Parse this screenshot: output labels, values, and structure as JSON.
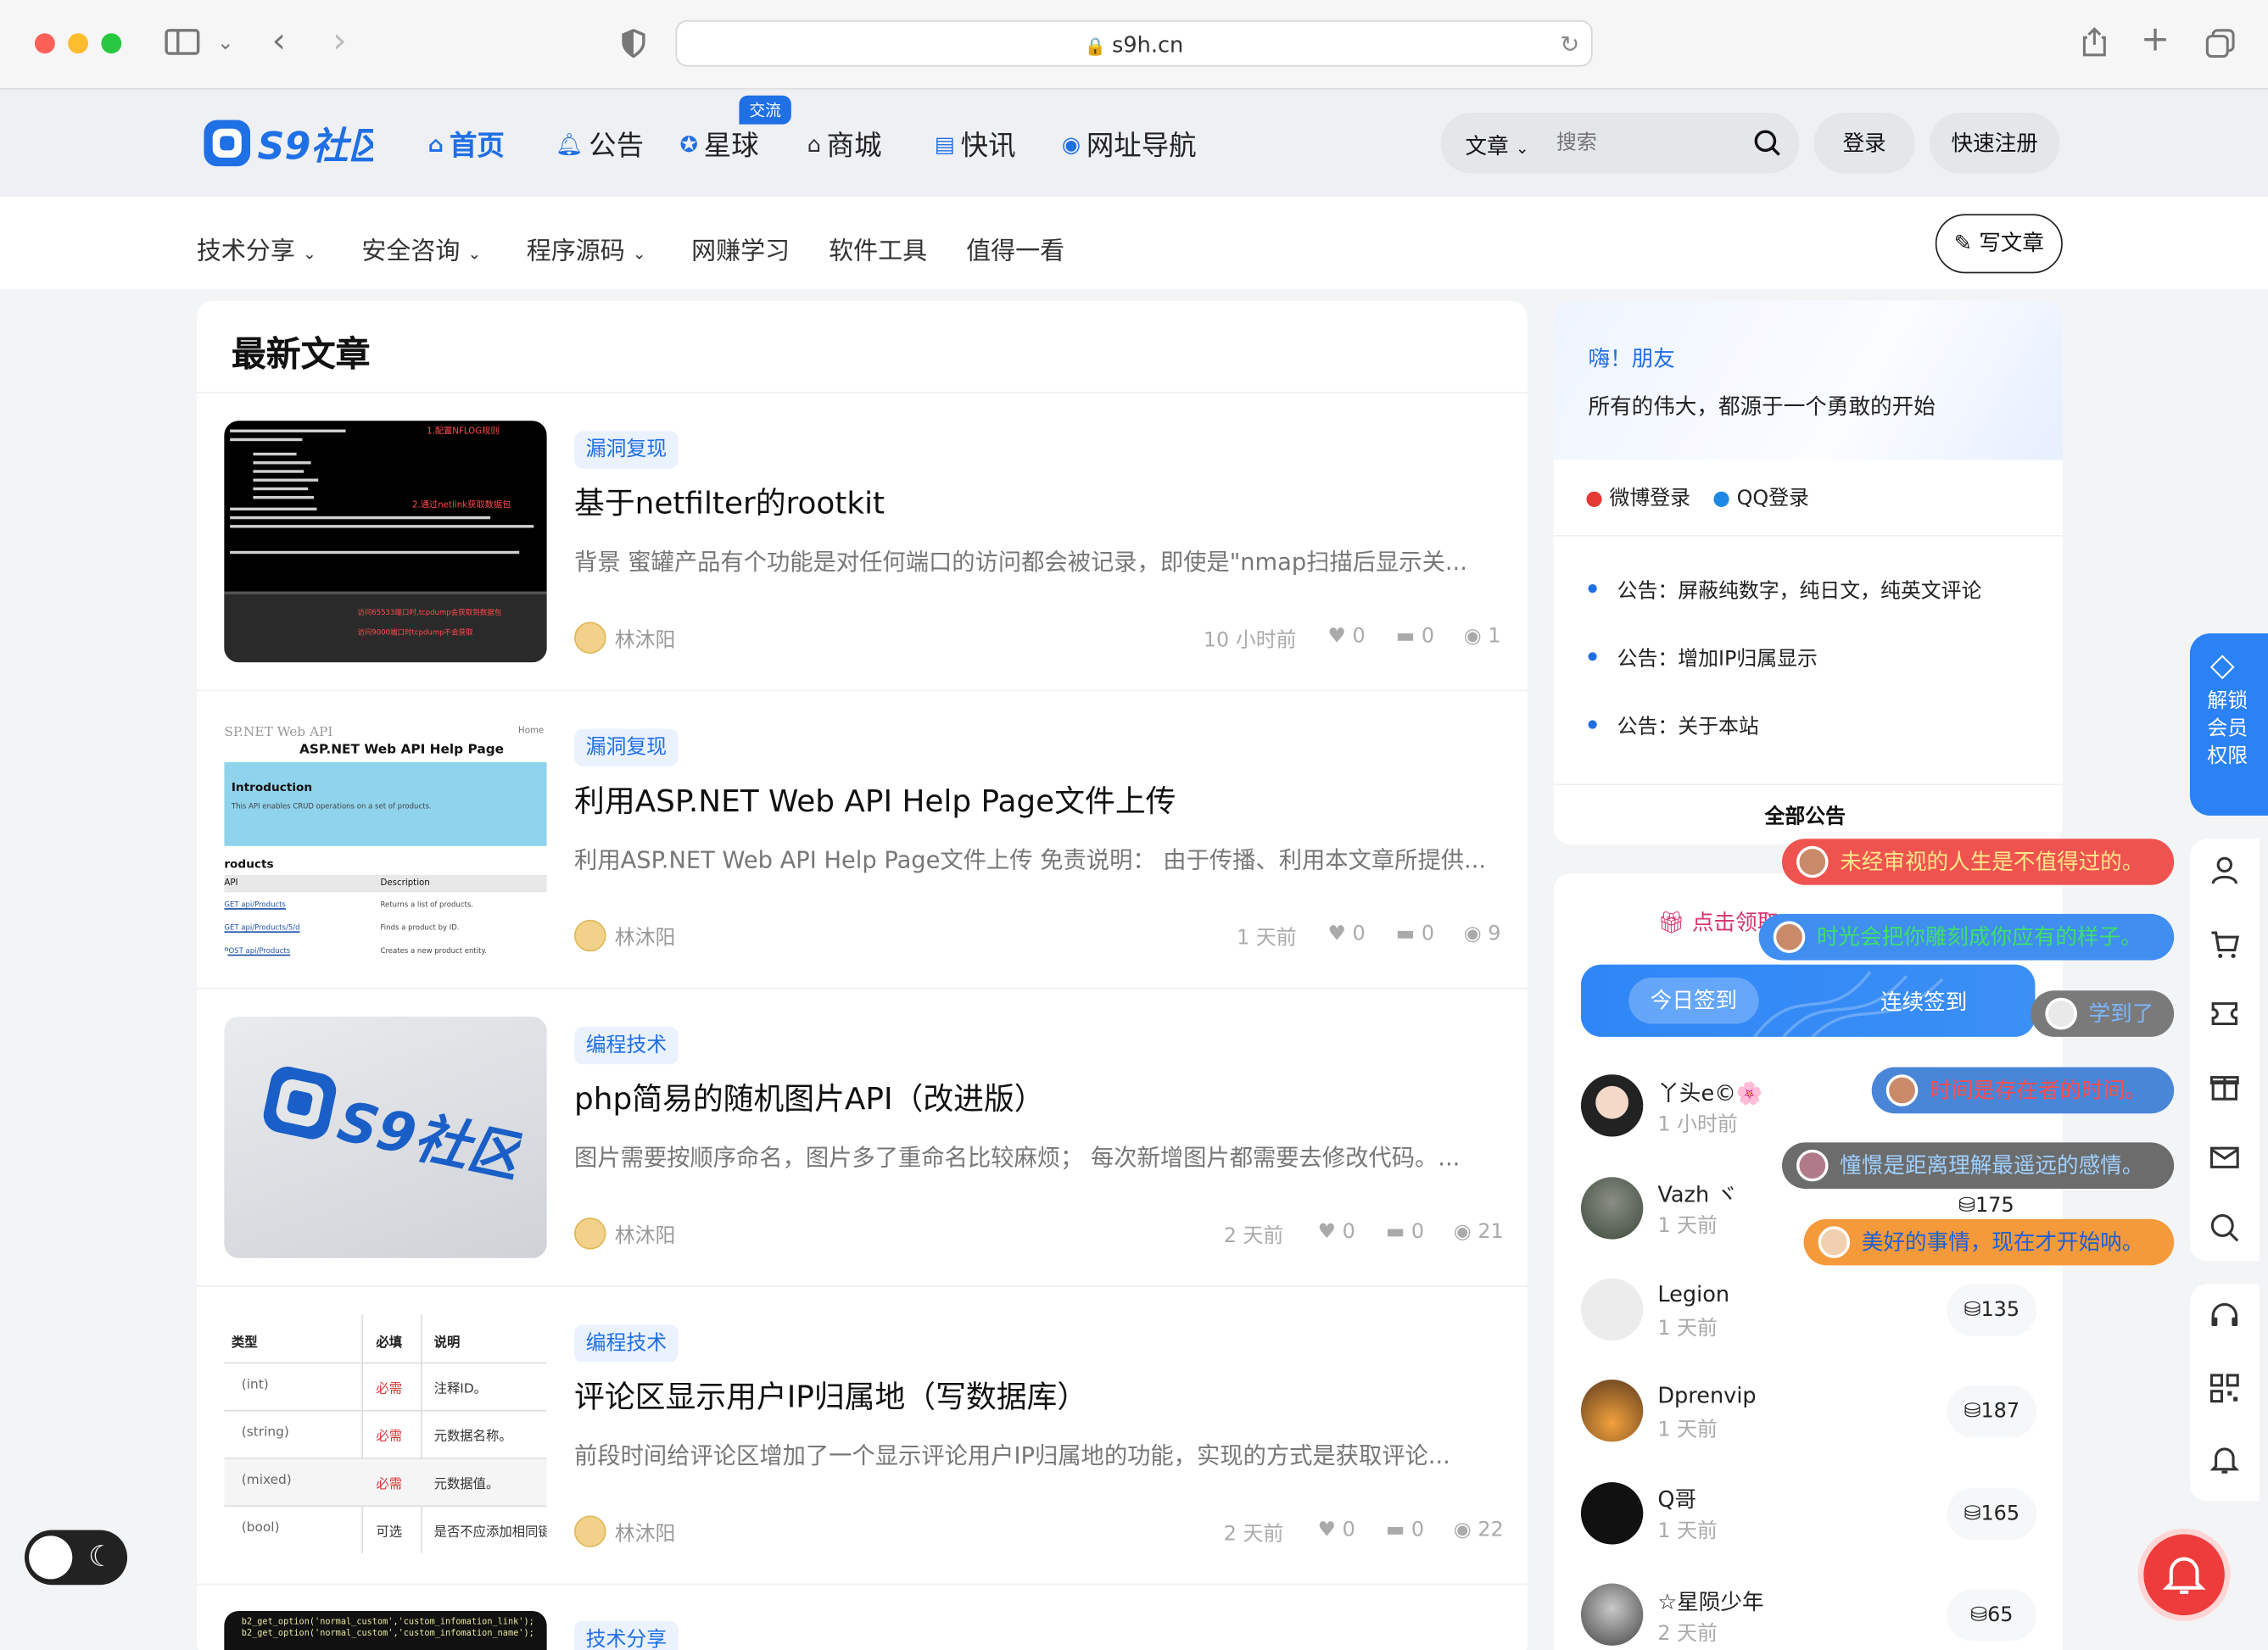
{
  "browser": {
    "url": "s9h.cn"
  },
  "site": {
    "logo_text": "S9社区",
    "nav": [
      {
        "label": "首页",
        "icon": "home-icon"
      },
      {
        "label": "公告",
        "icon": "bell-icon"
      },
      {
        "label": "星球",
        "icon": "planet-icon",
        "badge": "交流"
      },
      {
        "label": "商城",
        "icon": "store-icon"
      },
      {
        "label": "快讯",
        "icon": "news-icon"
      },
      {
        "label": "网址导航",
        "icon": "location-icon"
      }
    ],
    "search": {
      "type_label": "文章",
      "placeholder": "搜索"
    },
    "login_label": "登录",
    "register_label": "快速注册",
    "subnav": [
      "技术分享",
      "安全咨询",
      "程序源码",
      "网赚学习",
      "软件工具",
      "值得一看"
    ],
    "write_label": "写文章"
  },
  "main": {
    "title": "最新文章",
    "articles": [
      {
        "tag": "漏洞复现",
        "title": "基于netfilter的rootkit",
        "excerpt": "背景 蜜罐产品有个功能是对任何端口的访问都会被记录，即使是\"nmap扫描后显示关...",
        "author": "林沐阳",
        "time": "10 小时前",
        "likes": "0",
        "comments": "0",
        "views": "1"
      },
      {
        "tag": "漏洞复现",
        "title": "利用ASP.NET Web API Help Page文件上传",
        "excerpt": "利用ASP.NET Web API Help Page文件上传 免责说明： 由于传播、利用本文章所提供...",
        "author": "林沐阳",
        "time": "1 天前",
        "likes": "0",
        "comments": "0",
        "views": "9"
      },
      {
        "tag": "编程技术",
        "title": "php简易的随机图片API（改进版）",
        "excerpt": "图片需要按顺序命名，图片多了重命名比较麻烦； 每次新增图片都需要去修改代码。...",
        "author": "林沐阳",
        "time": "2 天前",
        "likes": "0",
        "comments": "0",
        "views": "21"
      },
      {
        "tag": "编程技术",
        "title": "评论区显示用户IP归属地（写数据库）",
        "excerpt": "前段时间给评论区增加了一个显示评论用户IP归属地的功能，实现的方式是获取评论...",
        "author": "林沐阳",
        "time": "2 天前",
        "likes": "0",
        "comments": "0",
        "views": "22"
      },
      {
        "tag": "技术分享"
      }
    ],
    "thumb1": {
      "lines": [
        "1.配置NFLOG规则",
        "2.通过netlink获取数据包",
        "访问65533端口时,tcpdump会获取到数据包",
        "访问9000端口时tcpdump不会获取"
      ]
    },
    "thumb2": {
      "head": "SP.NET Web API",
      "home": "Home",
      "title": "ASP.NET Web API Help Page",
      "intro": "Introduction",
      "intro_sub": "This API enables CRUD operations on a set of products.",
      "section": "roducts",
      "col1": "API",
      "col2": "Description",
      "rows": [
        [
          "GET api/Products",
          "Returns a list of products."
        ],
        [
          "GET api/Products/5/d",
          "Finds a product by ID."
        ],
        [
          "POST api/Products",
          "Creates a new product entity."
        ]
      ]
    },
    "thumb4": {
      "headers": [
        "类型",
        "必填",
        "说明"
      ],
      "rows": [
        [
          "(int)",
          "必需",
          "注释ID。"
        ],
        [
          "(string)",
          "必需",
          "元数据名称。"
        ],
        [
          "(mixed)",
          "必需",
          "元数据值。"
        ],
        [
          "(bool)",
          "可选",
          "是否不应添加相同键"
        ]
      ]
    },
    "thumb5": {
      "lines": [
        "b2_get_option('normal_custom','custom_infomation_link');",
        "b2_get_option('normal_custom','custom_infomation_name');"
      ]
    }
  },
  "sidebar": {
    "greeting": "嗨！朋友",
    "motto": "所有的伟大，都源于一个勇敢的开始",
    "weibo_login": "微博登录",
    "qq_login": "QQ登录",
    "notices": [
      "公告：屏蔽纯数字，纯日文，纯英文评论",
      "公告：增加IP归属显示",
      "公告：关于本站"
    ],
    "all_notices": "全部公告",
    "gift_text": "点击领取",
    "checkin_today": "今日签到",
    "checkin_streak": "连续签到",
    "users": [
      {
        "name": "丫头e©🌸",
        "time": "1 小时前",
        "coins": ""
      },
      {
        "name": "Vazh ヾ",
        "time": "1 天前",
        "coins": "175"
      },
      {
        "name": "Legion",
        "time": "1 天前",
        "coins": "135"
      },
      {
        "name": "Dprenvip",
        "time": "1 天前",
        "coins": "187"
      },
      {
        "name": "Q哥",
        "time": "1 天前",
        "coins": "165"
      },
      {
        "name": "☆星陨少年",
        "time": "2 天前",
        "coins": "65"
      }
    ],
    "danmu": [
      {
        "text": "未经审视的人生是不值得过的。",
        "bg": "#ef5350",
        "color": "#ffe88a"
      },
      {
        "text": "时光会把你雕刻成你应有的样子。",
        "bg": "#3f8ef0",
        "color": "#3fe06a"
      },
      {
        "text": "学到了",
        "bg": "#7a7a7a",
        "color": "#7ab6ff"
      },
      {
        "text": "时间是存在者的时间。",
        "bg": "#4a86d8",
        "color": "#ff4d4d"
      },
      {
        "text": "憧憬是距离理解最遥远的感情。",
        "bg": "#6c6c6c",
        "color": "#9fd0ff"
      },
      {
        "text": "美好的事情，现在才开始呐。",
        "bg": "#f59a3a",
        "color": "#1e5fd6"
      }
    ],
    "unlock_vip": "解锁会员权限"
  }
}
